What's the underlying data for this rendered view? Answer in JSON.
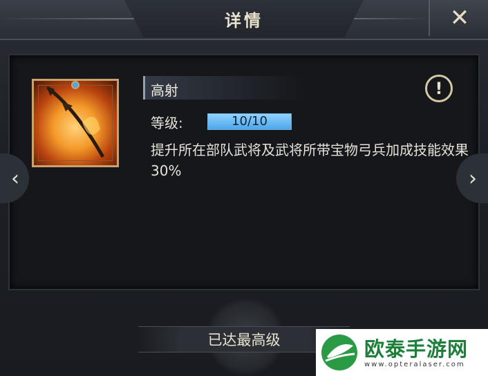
{
  "header": {
    "title": "详情",
    "close_icon": "close-x-icon"
  },
  "skill": {
    "name": "高射",
    "icon": "flaming-spear-icon",
    "level_label": "等级:",
    "level_value": "10/10",
    "level_fraction": 1.0,
    "description": "提升所在部队武将及武将所带宝物弓兵加成技能效果30%",
    "info_icon": "exclamation-icon"
  },
  "nav": {
    "prev_icon": "chevron-left-icon",
    "next_icon": "chevron-right-icon"
  },
  "footer": {
    "status": "已达最高级"
  },
  "watermark": {
    "title": "欧泰手游网",
    "url": "www.opteralaser.com"
  },
  "colors": {
    "accent_blue": "#6ab2e6",
    "frame_gold": "#c9a36a",
    "brand_green": "#1d7f3a"
  }
}
